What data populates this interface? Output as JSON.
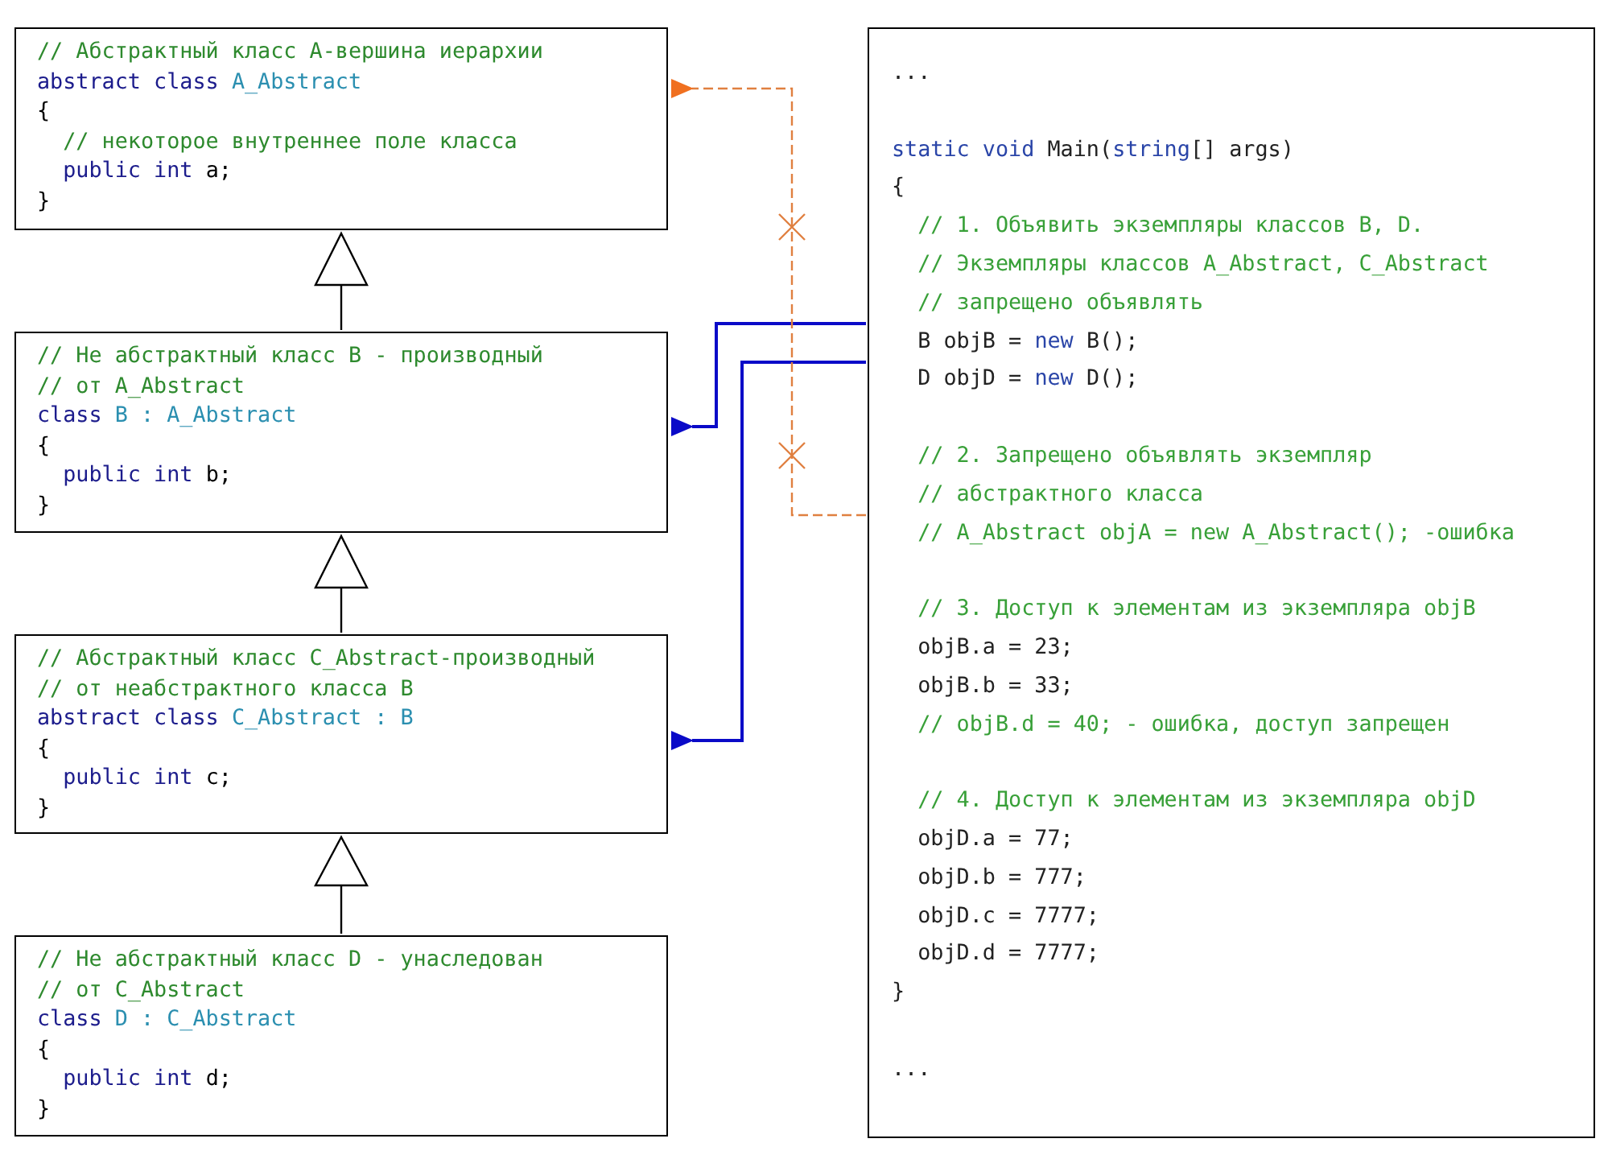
{
  "class_boxes": [
    {
      "lines": [
        [
          {
            "kind": "comment",
            "text": "// Абстрактный класс A-вершина иерархии"
          }
        ],
        [
          {
            "kind": "keyword",
            "text": "abstract class "
          },
          {
            "kind": "type",
            "text": "A_Abstract"
          }
        ],
        [
          {
            "kind": "plain",
            "text": "{"
          }
        ],
        [
          {
            "kind": "comment",
            "text": "  // некоторое внутреннее поле класса"
          }
        ],
        [
          {
            "kind": "keyword",
            "text": "  public int "
          },
          {
            "kind": "plain",
            "text": "a;"
          }
        ],
        [
          {
            "kind": "plain",
            "text": "}"
          }
        ]
      ]
    },
    {
      "lines": [
        [
          {
            "kind": "comment",
            "text": "// Не абстрактный класс B - производный"
          }
        ],
        [
          {
            "kind": "comment",
            "text": "// от A_Abstract"
          }
        ],
        [
          {
            "kind": "keyword",
            "text": "class "
          },
          {
            "kind": "type",
            "text": "B : A_Abstract"
          }
        ],
        [
          {
            "kind": "plain",
            "text": "{"
          }
        ],
        [
          {
            "kind": "keyword",
            "text": "  public int "
          },
          {
            "kind": "plain",
            "text": "b;"
          }
        ],
        [
          {
            "kind": "plain",
            "text": "}"
          }
        ]
      ]
    },
    {
      "lines": [
        [
          {
            "kind": "comment",
            "text": "// Абстрактный класс C_Abstract-производный"
          }
        ],
        [
          {
            "kind": "comment",
            "text": "// от неабстрактного класса B"
          }
        ],
        [
          {
            "kind": "keyword",
            "text": "abstract class "
          },
          {
            "kind": "type",
            "text": "C_Abstract : B"
          }
        ],
        [
          {
            "kind": "plain",
            "text": "{"
          }
        ],
        [
          {
            "kind": "keyword",
            "text": "  public int "
          },
          {
            "kind": "plain",
            "text": "c;"
          }
        ],
        [
          {
            "kind": "plain",
            "text": "}"
          }
        ]
      ]
    },
    {
      "lines": [
        [
          {
            "kind": "comment",
            "text": "// Не абстрактный класс D - унаследован"
          }
        ],
        [
          {
            "kind": "comment",
            "text": "// от C_Abstract"
          }
        ],
        [
          {
            "kind": "keyword",
            "text": "class "
          },
          {
            "kind": "type",
            "text": "D : C_Abstract"
          }
        ],
        [
          {
            "kind": "plain",
            "text": "{"
          }
        ],
        [
          {
            "kind": "keyword",
            "text": "  public int "
          },
          {
            "kind": "plain",
            "text": "d;"
          }
        ],
        [
          {
            "kind": "plain",
            "text": "}"
          }
        ]
      ]
    }
  ],
  "main_code": {
    "lines": [
      {
        "kind": "code",
        "tokens": [
          {
            "kind": "plain",
            "text": "..."
          }
        ]
      },
      {
        "kind": "blank"
      },
      {
        "kind": "code",
        "tokens": [
          {
            "kind": "keyword",
            "text": "static void "
          },
          {
            "kind": "plain",
            "text": "Main("
          },
          {
            "kind": "keyword",
            "text": "string"
          },
          {
            "kind": "plain",
            "text": "[] args)"
          }
        ]
      },
      {
        "kind": "code",
        "tokens": [
          {
            "kind": "plain",
            "text": "{"
          }
        ]
      },
      {
        "kind": "code",
        "tokens": [
          {
            "kind": "comment",
            "text": "  // 1. Объявить экземпляры классов B, D."
          }
        ]
      },
      {
        "kind": "code",
        "tokens": [
          {
            "kind": "comment",
            "text": "  // Экземпляры классов A_Abstract, C_Abstract"
          }
        ]
      },
      {
        "kind": "code",
        "tokens": [
          {
            "kind": "comment",
            "text": "  // запрещено объявлять"
          }
        ]
      },
      {
        "kind": "code",
        "tokens": [
          {
            "kind": "plain",
            "text": "  B objB = "
          },
          {
            "kind": "keyword",
            "text": "new "
          },
          {
            "kind": "plain",
            "text": "B();"
          }
        ]
      },
      {
        "kind": "code",
        "tokens": [
          {
            "kind": "plain",
            "text": "  D objD = "
          },
          {
            "kind": "keyword",
            "text": "new "
          },
          {
            "kind": "plain",
            "text": "D();"
          }
        ]
      },
      {
        "kind": "blank"
      },
      {
        "kind": "code",
        "tokens": [
          {
            "kind": "comment",
            "text": "  // 2. Запрещено объявлять экземпляр"
          }
        ]
      },
      {
        "kind": "code",
        "tokens": [
          {
            "kind": "comment",
            "text": "  // абстрактного класса"
          }
        ]
      },
      {
        "kind": "code",
        "tokens": [
          {
            "kind": "comment",
            "text": "  // A_Abstract objA = new A_Abstract(); -ошибка"
          }
        ]
      },
      {
        "kind": "blank"
      },
      {
        "kind": "code",
        "tokens": [
          {
            "kind": "comment",
            "text": "  // 3. Доступ к элементам из экземпляра objB"
          }
        ]
      },
      {
        "kind": "code",
        "tokens": [
          {
            "kind": "plain",
            "text": "  objB.a = 23;"
          }
        ]
      },
      {
        "kind": "code",
        "tokens": [
          {
            "kind": "plain",
            "text": "  objB.b = 33;"
          }
        ]
      },
      {
        "kind": "code",
        "tokens": [
          {
            "kind": "comment",
            "text": "  // objB.d = 40; - ошибка, доступ запрещен"
          }
        ]
      },
      {
        "kind": "blank"
      },
      {
        "kind": "code",
        "tokens": [
          {
            "kind": "comment",
            "text": "  // 4. Доступ к элементам из экземпляра objD"
          }
        ]
      },
      {
        "kind": "code",
        "tokens": [
          {
            "kind": "plain",
            "text": "  objD.a = 77;"
          }
        ]
      },
      {
        "kind": "code",
        "tokens": [
          {
            "kind": "plain",
            "text": "  objD.b = 777;"
          }
        ]
      },
      {
        "kind": "code",
        "tokens": [
          {
            "kind": "plain",
            "text": "  objD.c = 7777;"
          }
        ]
      },
      {
        "kind": "code",
        "tokens": [
          {
            "kind": "plain",
            "text": "  objD.d = 7777;"
          }
        ]
      },
      {
        "kind": "code",
        "tokens": [
          {
            "kind": "plain",
            "text": "}"
          }
        ]
      },
      {
        "kind": "blank"
      },
      {
        "kind": "code",
        "tokens": [
          {
            "kind": "plain",
            "text": "..."
          }
        ]
      }
    ]
  }
}
